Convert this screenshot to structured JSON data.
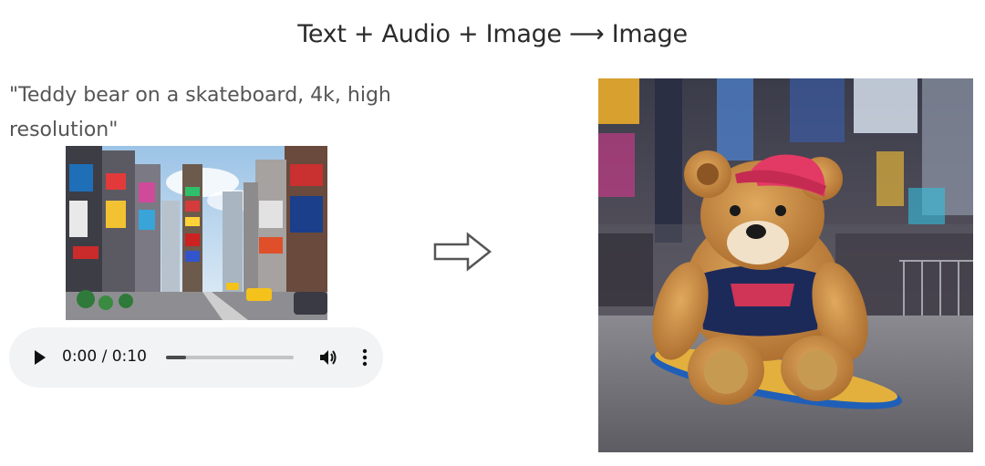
{
  "title": "Text + Audio + Image ⟶ Image",
  "prompt": "\"Teddy bear on a skateboard, 4k, high resolution\"",
  "audio_player": {
    "time": "0:00 / 0:10",
    "progress_fraction": 0.16,
    "icons": {
      "play": "play-icon",
      "volume": "volume-icon",
      "menu": "more-vertical-icon"
    }
  },
  "images": {
    "input": "times-square-street-photo",
    "output": "teddy-bear-on-skateboard-photo"
  },
  "arrow_icon": "right-arrow-icon",
  "colors": {
    "title_text": "#2b2b2b",
    "prompt_text": "#555555",
    "player_background": "#f1f3f4",
    "progress_fill": "#4a4a4a",
    "progress_track": "#c4c4c4"
  }
}
